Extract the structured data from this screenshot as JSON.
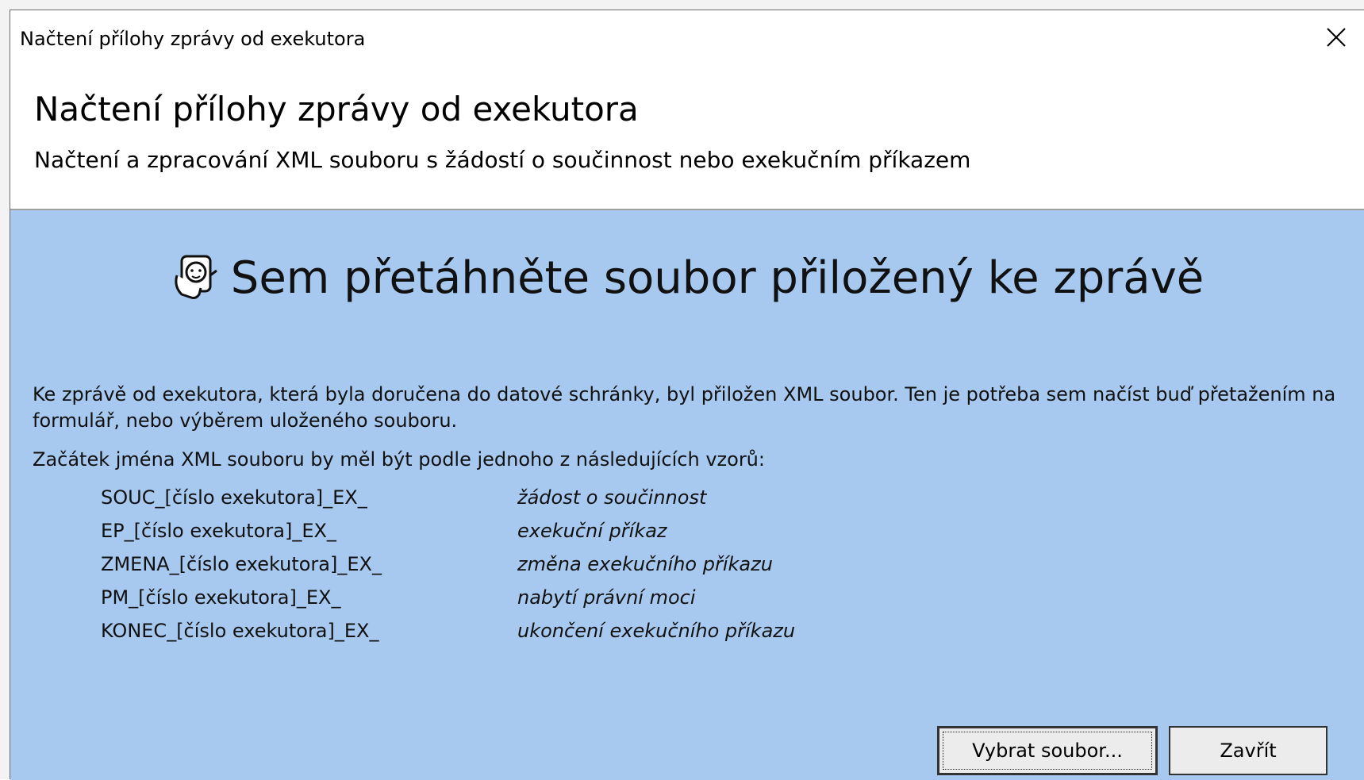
{
  "window": {
    "title": "Načtení přílohy zprávy od exekutora"
  },
  "header": {
    "title": "Načtení přílohy zprávy od exekutora",
    "subtitle": "Načtení a zpracování XML souboru s žádostí o součinnost nebo exekučním příkazem"
  },
  "drop_zone": {
    "heading": "Sem přetáhněte soubor přiložený ke zprávě",
    "icon": "drag-file-icon"
  },
  "description": "Ke zprávě od exekutora, která byla doručena do datové schránky, byl přiložen XML soubor. Ten je potřeba sem načíst buď přetažením na formulář, nebo výběrem uloženého souboru.",
  "pattern_intro": "Začátek jména XML souboru by měl být podle jednoho z následujících vzorů:",
  "patterns": [
    {
      "code": "SOUC_[číslo exekutora]_EX_",
      "desc": "žádost o součinnost"
    },
    {
      "code": "EP_[číslo exekutora]_EX_",
      "desc": "exekuční příkaz"
    },
    {
      "code": "ZMENA_[číslo exekutora]_EX_",
      "desc": "změna exekučního příkazu"
    },
    {
      "code": "PM_[číslo exekutora]_EX_",
      "desc": "nabytí právní moci"
    },
    {
      "code": "KONEC_[číslo exekutora]_EX_",
      "desc": "ukončení exekučního příkazu"
    }
  ],
  "buttons": {
    "select_file": "Vybrat soubor...",
    "close": "Zavřít"
  },
  "colors": {
    "content_background": "#a7c9ef",
    "header_background": "#ffffff"
  }
}
